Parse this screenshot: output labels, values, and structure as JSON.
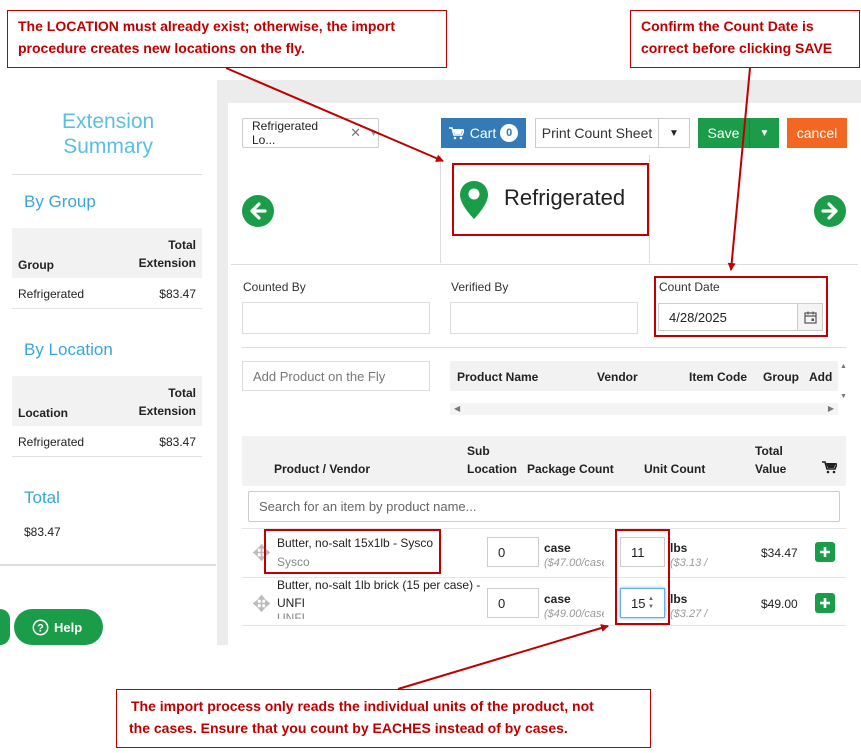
{
  "callouts": {
    "location_line1": "The LOCATION must already exist; otherwise, the import",
    "location_line2": "procedure creates new locations on the fly.",
    "date_line1": "Confirm the Count Date is",
    "date_line2": "correct before clicking SAVE",
    "units_line1": "The import process only reads the individual units of the product, not",
    "units_line2": "the cases. Ensure that you count by EACHES instead of by cases."
  },
  "sidebar": {
    "title_line1": "Extension",
    "title_line2": "Summary",
    "by_group": {
      "heading": "By Group",
      "col1": "Group",
      "col2_line1": "Total",
      "col2_line2": "Extension",
      "rows": [
        {
          "name": "Refrigerated",
          "value": "$83.47"
        }
      ]
    },
    "by_location": {
      "heading": "By Location",
      "col1": "Location",
      "col2_line1": "Total",
      "col2_line2": "Extension",
      "rows": [
        {
          "name": "Refrigerated",
          "value": "$83.47"
        }
      ]
    },
    "total_heading": "Total",
    "total_value": "$83.47"
  },
  "toolbar": {
    "location_select": "Refrigerated Lo...",
    "cart_label": "Cart",
    "cart_count": "0",
    "print_label": "Print Count Sheet",
    "save_label": "Save",
    "cancel_label": "cancel"
  },
  "location_name": "Refrigerated",
  "form": {
    "counted_by_label": "Counted By",
    "verified_by_label": "Verified By",
    "count_date_label": "Count Date",
    "count_date_value": "4/28/2025"
  },
  "fly": {
    "placeholder": "Add Product on the Fly",
    "columns": [
      "Product Name",
      "Vendor",
      "Item Code",
      "Group",
      "Add"
    ]
  },
  "grid": {
    "col_product": "Product / Vendor",
    "col_sub_line1": "Sub",
    "col_sub_line2": "Location",
    "col_package": "Package Count",
    "col_unit": "Unit Count",
    "col_total_line1": "Total",
    "col_total_line2": "Value",
    "search_placeholder": "Search for an item by product name...",
    "rows": [
      {
        "name_line1": "Butter, no-salt 15x1lb - Sysco",
        "vendor": "Sysco",
        "package_count": "0",
        "package_unit": "case",
        "package_price": "($47.00/case",
        "unit_count": "11",
        "unit_unit": "lbs",
        "unit_price": "($3.13 /",
        "total": "$34.47"
      },
      {
        "name_line1": "Butter, no-salt 1lb brick (15 per case) -",
        "name_line2": "UNFI",
        "vendor": "UNFI",
        "package_count": "0",
        "package_unit": "case",
        "package_price": "($49.00/case",
        "unit_count": "15",
        "unit_unit": "lbs",
        "unit_price": "($3.27 /",
        "total": "$49.00"
      }
    ]
  },
  "help_label": "Help",
  "colors": {
    "green": "#1a9c48",
    "blue": "#337ab7",
    "orange": "#f26722",
    "red_annotation": "#c00000",
    "sidebar_blue": "#5bc0de"
  }
}
